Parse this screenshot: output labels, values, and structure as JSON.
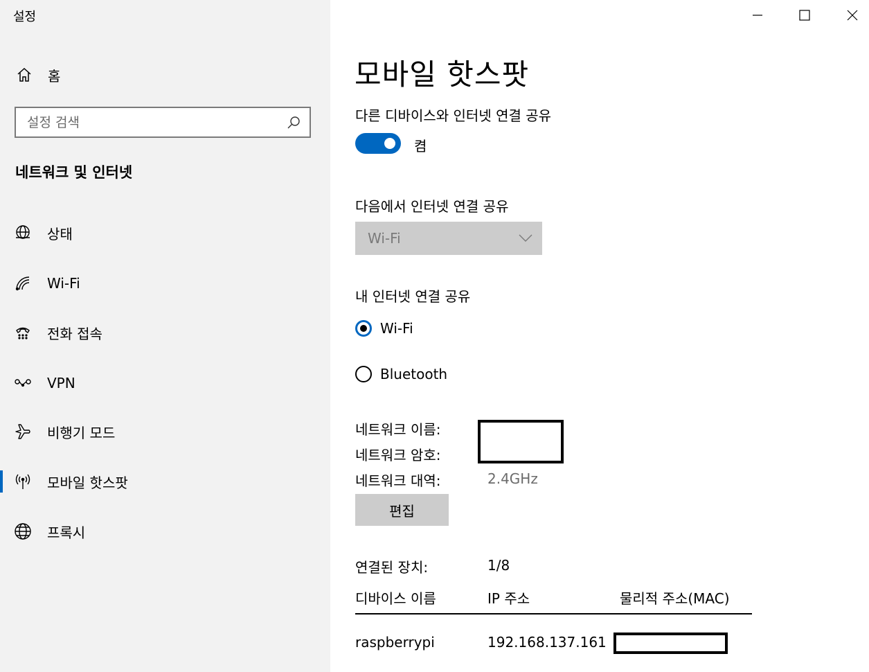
{
  "window": {
    "title": "설정"
  },
  "sidebar": {
    "home_label": "홈",
    "search_placeholder": "설정 검색",
    "section_title": "네트워크 및 인터넷",
    "items": [
      {
        "label": "상태",
        "icon": "globe-status-icon"
      },
      {
        "label": "Wi-Fi",
        "icon": "wifi-icon"
      },
      {
        "label": "전화 접속",
        "icon": "dialup-phone-icon"
      },
      {
        "label": "VPN",
        "icon": "vpn-icon"
      },
      {
        "label": "비행기 모드",
        "icon": "airplane-icon"
      },
      {
        "label": "모바일 핫스팟",
        "icon": "hotspot-icon",
        "active": true
      },
      {
        "label": "프록시",
        "icon": "globe-icon"
      }
    ]
  },
  "main": {
    "title": "모바일 핫스팟",
    "share_label": "다른 디바이스와 인터넷 연결 공유",
    "toggle_state": "켬",
    "toggle_on": true,
    "share_from_label": "다음에서 인터넷 연결 공유",
    "share_from_value": "Wi-Fi",
    "share_over_label": "내 인터넷 연결 공유",
    "share_over_options": [
      {
        "label": "Wi-Fi",
        "checked": true
      },
      {
        "label": "Bluetooth",
        "checked": false
      }
    ],
    "network_name_label": "네트워크 이름:",
    "network_password_label": "네트워크 암호:",
    "network_band_label": "네트워크 대역:",
    "network_band_value": "2.4GHz",
    "edit_button": "편집",
    "connected_label": "연결된 장치:",
    "connected_value": "1/8",
    "columns": [
      "디바이스 이름",
      "IP 주소",
      "물리적 주소(MAC)"
    ],
    "devices": [
      {
        "name": "raspberrypi",
        "ip": "192.168.137.161"
      }
    ]
  },
  "colors": {
    "accent": "#0067c0",
    "sidebar_bg": "#f2f2f2",
    "disabled_bg": "#cccccc"
  }
}
